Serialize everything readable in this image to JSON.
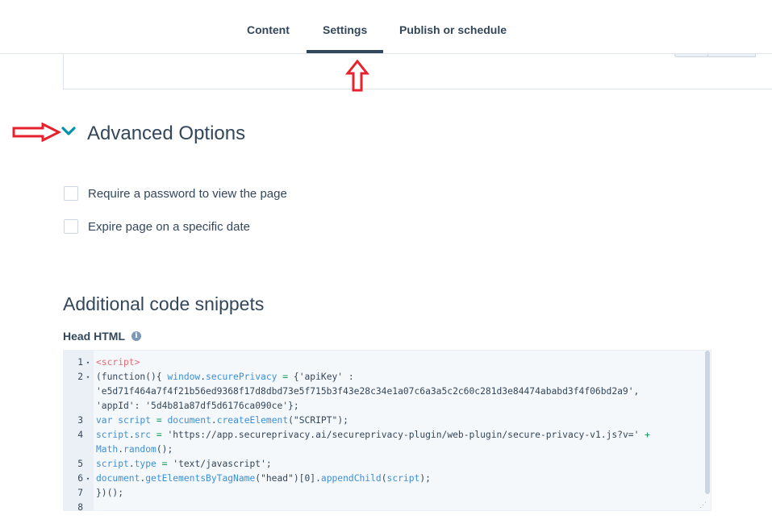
{
  "tabs": [
    {
      "label": "Content"
    },
    {
      "label": "Settings"
    },
    {
      "label": "Publish or schedule"
    }
  ],
  "advanced": {
    "title": "Advanced Options",
    "options": [
      {
        "label": "Require a password to view the page",
        "checked": false
      },
      {
        "label": "Expire page on a specific date",
        "checked": false
      }
    ]
  },
  "snippets": {
    "title": "Additional code snippets",
    "head_label": "Head HTML",
    "info_glyph": "i"
  },
  "code": [
    {
      "num": "1",
      "fold": true,
      "text": "<script>"
    },
    {
      "num": "2",
      "fold": true,
      "text": "(function(){ window.securePrivacy = {'apiKey' :"
    },
    {
      "num": "",
      "fold": false,
      "text": "'e5d71f464a7f4f21b56ed9368f17d8dbd73e5f715b3f43e28c34e1a07c6a3a5c2c60c281d3e84474ababd3f4f06bd2a9',"
    },
    {
      "num": "",
      "fold": false,
      "text": "'appId': '5d4b81a87df5d6176ca090ce'};"
    },
    {
      "num": "3",
      "fold": false,
      "text": "var script = document.createElement(\"SCRIPT\");"
    },
    {
      "num": "4",
      "fold": false,
      "text": "script.src = 'https://app.secureprivacy.ai/secureprivacy-plugin/web-plugin/secure-privacy-v1.js?v=' +"
    },
    {
      "num": "",
      "fold": false,
      "text": "Math.random();"
    },
    {
      "num": "5",
      "fold": false,
      "text": "script.type = 'text/javascript';"
    },
    {
      "num": "6",
      "fold": true,
      "text": "document.getElementsByTagName(\"head\")[0].appendChild(script);"
    },
    {
      "num": "7",
      "fold": false,
      "text": "})();"
    },
    {
      "num": "8",
      "fold": false,
      "text": ""
    }
  ],
  "colors": {
    "accent_teal": "#0091ae",
    "annotation_red": "#e8212e",
    "text": "#33475b"
  }
}
